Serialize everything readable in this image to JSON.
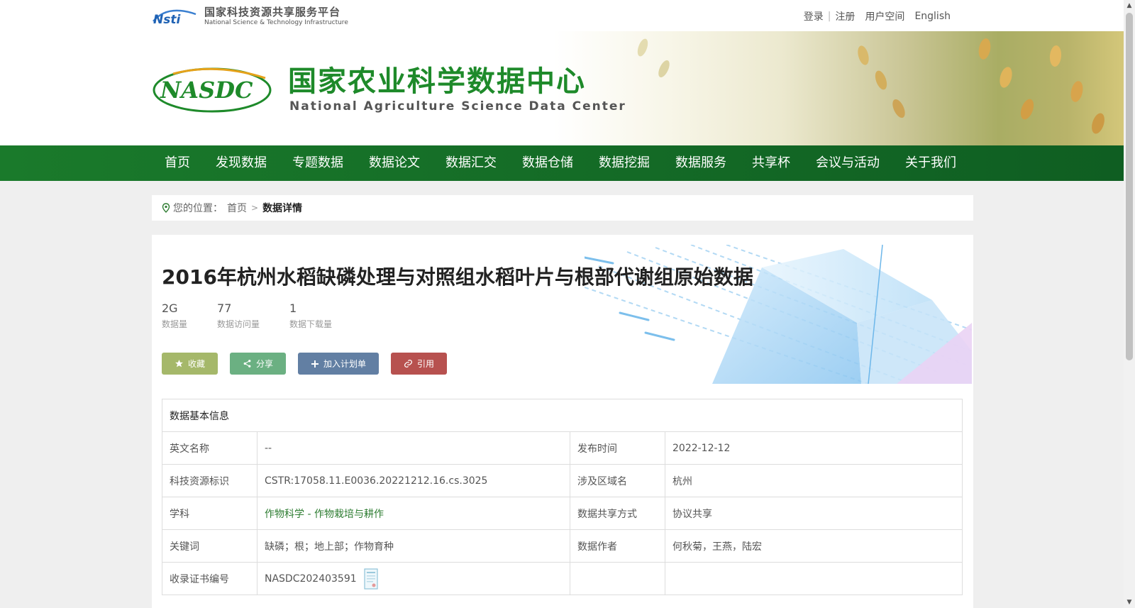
{
  "topbar": {
    "platform_cn": "国家科技资源共享服务平台",
    "platform_en": "National Science & Technology Infrastructure",
    "logo_mark": "Nsti",
    "links": {
      "login": "登录",
      "register": "注册",
      "user_space": "用户空间",
      "english": "English"
    }
  },
  "banner": {
    "logo_mark": "NASDC",
    "title_cn": "国家农业科学数据中心",
    "title_en": "National Agriculture Science Data Center"
  },
  "nav": {
    "items": [
      {
        "label": "首页"
      },
      {
        "label": "发现数据"
      },
      {
        "label": "专题数据"
      },
      {
        "label": "数据论文"
      },
      {
        "label": "数据汇交"
      },
      {
        "label": "数据仓储"
      },
      {
        "label": "数据挖掘"
      },
      {
        "label": "数据服务"
      },
      {
        "label": "共享杯"
      },
      {
        "label": "会议与活动"
      },
      {
        "label": "关于我们"
      }
    ]
  },
  "breadcrumb": {
    "prefix": "您的位置：",
    "home": "首页",
    "separator": ">",
    "current": "数据详情"
  },
  "dataset": {
    "title": "2016年杭州水稻缺磷处理与对照组水稻叶片与根部代谢组原始数据",
    "stats": [
      {
        "value": "2G",
        "label": "数据量"
      },
      {
        "value": "77",
        "label": "数据访问量"
      },
      {
        "value": "1",
        "label": "数据下载量"
      }
    ],
    "actions": {
      "favorite": "收藏",
      "share": "分享",
      "add_plan": "加入计划单",
      "cite": "引用"
    }
  },
  "info_table": {
    "heading": "数据基本信息",
    "english_name_label": "英文名称",
    "english_name_value": "--",
    "publish_time_label": "发布时间",
    "publish_time_value": "2022-12-12",
    "resource_id_label": "科技资源标识",
    "resource_id_value": "CSTR:17058.11.E0036.20221212.16.cs.3025",
    "region_label": "涉及区域名",
    "region_value": "杭州",
    "subject_label": "学科",
    "subject_value": "作物科学 - 作物栽培与耕作",
    "sharing_label": "数据共享方式",
    "sharing_value": "协议共享",
    "keywords_label": "关键词",
    "keywords_value": "缺磷；根；地上部；作物育种",
    "authors_label": "数据作者",
    "authors_value": "何秋菊，王燕，陆宏",
    "cert_label": "收录证书编号",
    "cert_value": "NASDC202403591"
  },
  "colors": {
    "nav_green": "#1a7a2b",
    "brand_green": "#1e8a2a",
    "subject_link": "#2e7d32",
    "btn_favorite": "#a5b86a",
    "btn_share": "#6bb082",
    "btn_plan": "#627fa3",
    "btn_cite": "#b7514f"
  },
  "icons": [
    "location-pin-icon",
    "star-icon",
    "share-icon",
    "plus-icon",
    "link-icon",
    "certificate-icon"
  ]
}
